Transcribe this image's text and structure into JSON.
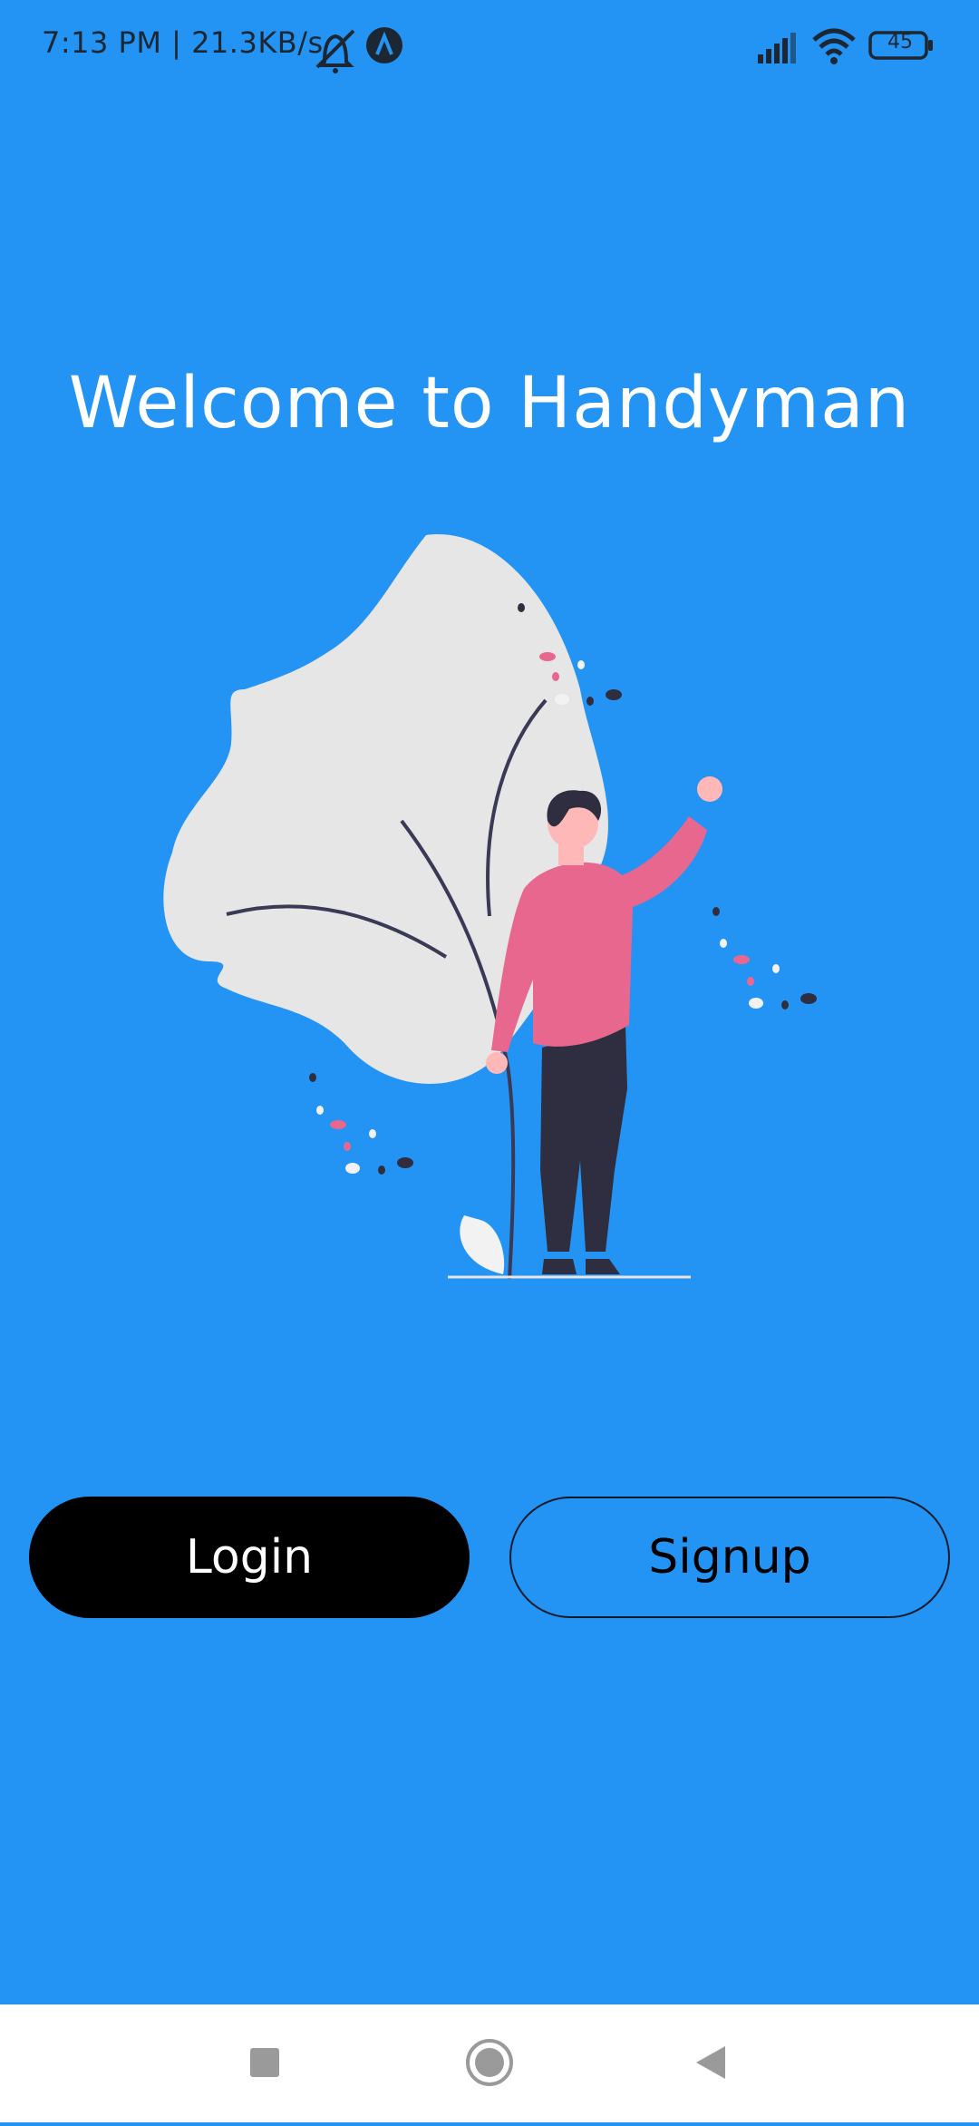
{
  "status_bar": {
    "time_speed": "7:13 PM | 21.3KB/s",
    "battery": "45"
  },
  "welcome": {
    "title": "Welcome to Handyman"
  },
  "buttons": {
    "login": "Login",
    "signup": "Signup"
  },
  "colors": {
    "background": "#2394F3",
    "login_bg": "#000000",
    "nav_bg": "#ffffff"
  },
  "icons": {
    "status": [
      "mute-icon",
      "app-a-icon",
      "signal-icon",
      "wifi-icon",
      "battery-icon"
    ],
    "nav": [
      "square-icon",
      "circle-home-icon",
      "back-triangle-icon"
    ]
  }
}
